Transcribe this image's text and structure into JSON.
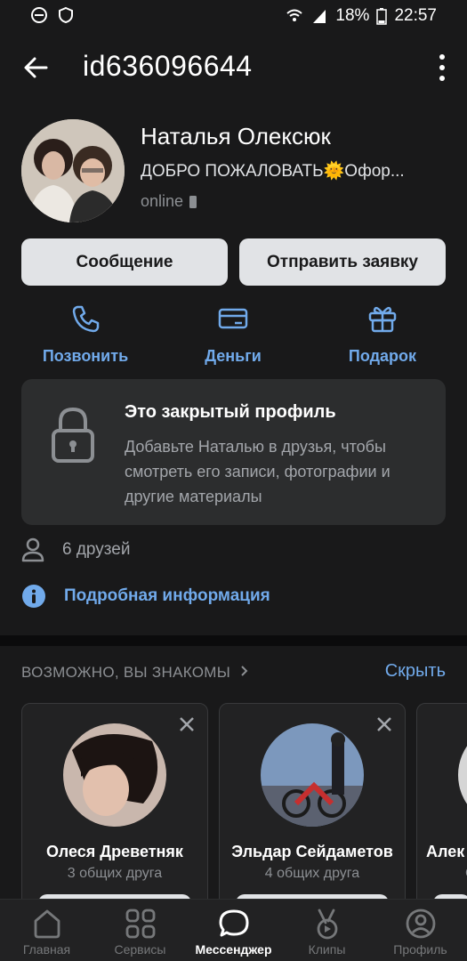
{
  "statusbar": {
    "battery": "18%",
    "time": "22:57"
  },
  "header": {
    "title": "id636096644"
  },
  "profile": {
    "name": "Наталья Олексюк",
    "status": "ДОБРО ПОЖАЛОВАТЬ🌞Офор...",
    "online": "online"
  },
  "buttons": {
    "message": "Сообщение",
    "request": "Отправить заявку"
  },
  "actions": {
    "call": "Позвонить",
    "money": "Деньги",
    "gift": "Подарок"
  },
  "closed": {
    "title": "Это закрытый профиль",
    "desc": "Добавьте Наталью в друзья, чтобы смотреть его записи, фотографии и другие материалы"
  },
  "info": {
    "friends": "6 друзей",
    "details": "Подробная информация"
  },
  "suggest": {
    "heading": "ВОЗМОЖНО, ВЫ ЗНАКОМЫ",
    "hide": "Скрыть",
    "cards": [
      {
        "name": "Олеся Древетняк",
        "mutual": "3 общих друга"
      },
      {
        "name": "Эльдар Сейдаметов",
        "mutual": "4 общих друга"
      },
      {
        "name": "Алек",
        "mutual": "С"
      }
    ]
  },
  "tabs": [
    {
      "label": "Главная",
      "icon": "home-icon"
    },
    {
      "label": "Сервисы",
      "icon": "services-icon"
    },
    {
      "label": "Мессенджер",
      "icon": "messenger-icon"
    },
    {
      "label": "Клипы",
      "icon": "clips-icon"
    },
    {
      "label": "Профиль",
      "icon": "profile-icon"
    }
  ],
  "colors": {
    "accent": "#71aaeb",
    "background": "#19191a",
    "card": "#2c2d2e"
  }
}
